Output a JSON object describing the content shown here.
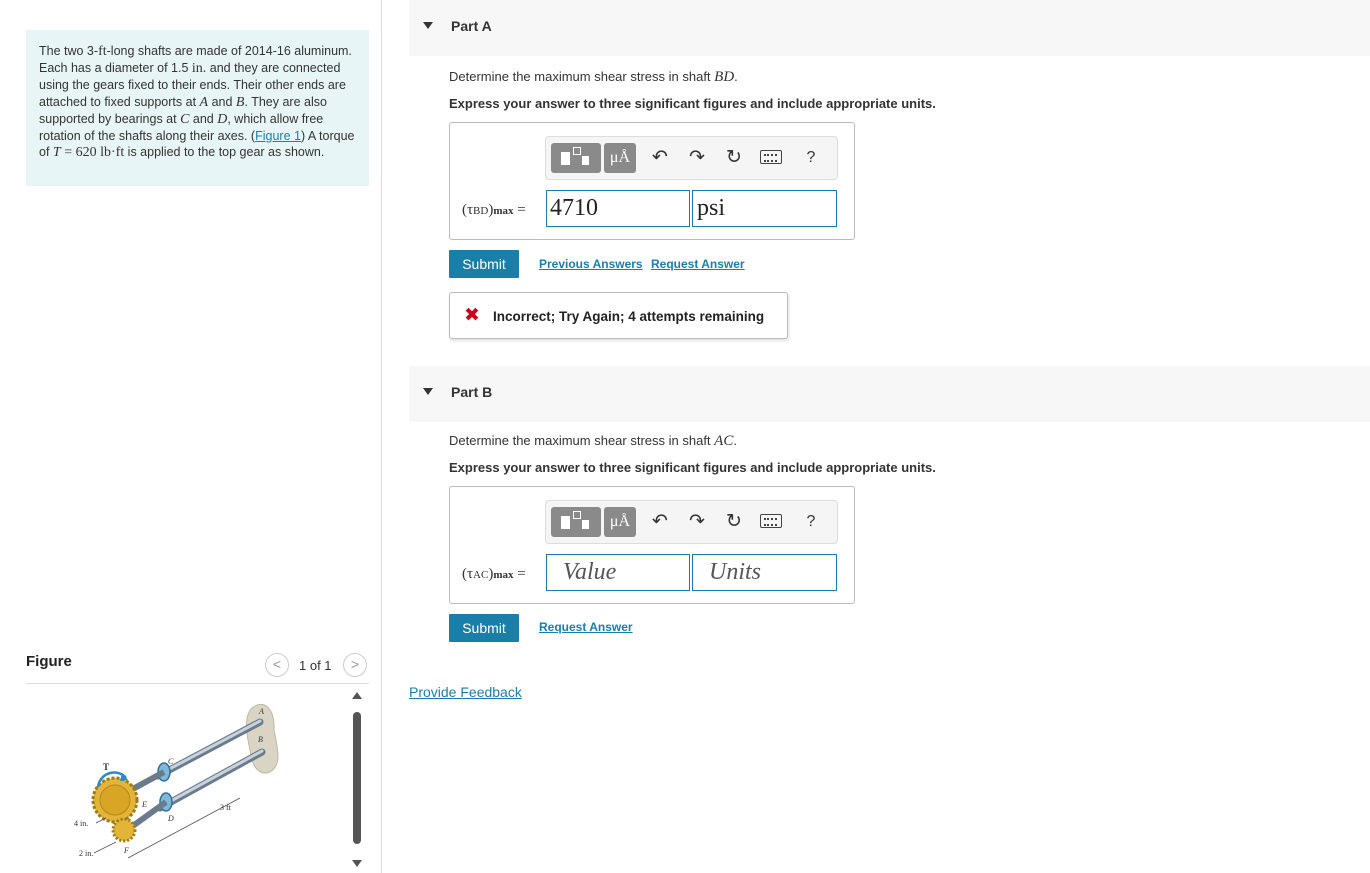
{
  "problem": {
    "text_1": "The two 3-",
    "unit_ft": "ft",
    "text_2": "-long shafts are made of 2014-16 aluminum. Each has a diameter of 1.5 ",
    "unit_in": "in.",
    "text_3": " and they are connected using the gears fixed to their ends. Their other ends are attached to fixed supports at ",
    "pt_A": "A",
    "and_1": " and ",
    "pt_B": "B",
    "text_4": ". They are also supported by bearings at ",
    "pt_C": "C",
    "and_2": " and ",
    "pt_D": "D",
    "text_5": ", which allow free rotation of the shafts along their axes. (",
    "fig_link": "Figure 1",
    "text_6": ") A torque of ",
    "torque_sym": "T",
    "torque_val": " = 620 lb·ft",
    "text_7": " is applied to the top gear as shown."
  },
  "figure": {
    "title": "Figure",
    "counter": "1 of 1",
    "prev": "<",
    "next": ">",
    "labels": {
      "A": "A",
      "B": "B",
      "C": "C",
      "D": "D",
      "E": "E",
      "F": "F",
      "T": "T",
      "len": "3 ft",
      "r1": "4 in.",
      "r2": "2 in."
    }
  },
  "partA": {
    "title": "Part A",
    "prompt_pre": "Determine the maximum shear stress in shaft ",
    "shaft": "BD",
    "prompt_post": ".",
    "instruction": "Express your answer to three significant figures and include appropriate units.",
    "var_tau": "(τ",
    "var_sub": "BD",
    "var_close": ")",
    "var_max": "max",
    "var_eq": " =",
    "value": "4710",
    "units": "psi",
    "submit": "Submit",
    "prev_answers": "Previous Answers",
    "request": "Request Answer",
    "feedback_icon": "✖",
    "feedback": "Incorrect; Try Again; 4 attempts remaining"
  },
  "partB": {
    "title": "Part B",
    "prompt_pre": "Determine the maximum shear stress in shaft ",
    "shaft": "AC",
    "prompt_post": ".",
    "instruction": "Express your answer to three significant figures and include appropriate units.",
    "var_tau": "(τ",
    "var_sub": "AC",
    "var_close": ")",
    "var_max": "max",
    "var_eq": " =",
    "value_placeholder": "Value",
    "units_placeholder": "Units",
    "submit": "Submit",
    "request": "Request Answer"
  },
  "toolbar": {
    "mu": "μÅ",
    "undo": "↶",
    "redo": "↷",
    "reset": "↻",
    "help": "?"
  },
  "footer": {
    "provide_feedback": "Provide Feedback"
  }
}
